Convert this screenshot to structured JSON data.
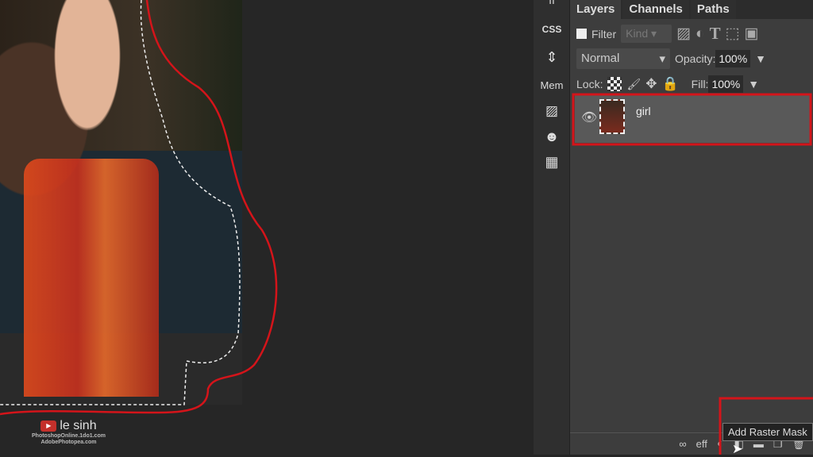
{
  "canvas": {
    "watermark": {
      "brand": "le sinh",
      "line1": "PhotoshopOnline.1do1.com",
      "line2": "AdobePhotopea.com"
    }
  },
  "toolbar": {
    "items": [
      {
        "label": "CSS",
        "icon": "css-icon"
      },
      {
        "label": "",
        "icon": "ruler-icon"
      },
      {
        "label": "Mem",
        "icon": "memory-icon"
      },
      {
        "label": "",
        "icon": "image-icon"
      },
      {
        "label": "",
        "icon": "emoji-icon"
      },
      {
        "label": "",
        "icon": "qr-code-icon"
      }
    ]
  },
  "layers_panel": {
    "tabs": [
      "Layers",
      "Channels",
      "Paths"
    ],
    "filter_label": "Filter",
    "kind_placeholder": "Kind",
    "blend_mode": "Normal",
    "opacity_label": "Opacity:",
    "opacity": "100%",
    "lock_label": "Lock:",
    "fill_label": "Fill:",
    "fill": "100%",
    "layers": [
      {
        "name": "girl",
        "visible": true,
        "selected": true
      }
    ],
    "bottom_icons": [
      "link-icon",
      "eff",
      "adjustment-icon",
      "mask-icon",
      "folder-icon",
      "new-layer-icon",
      "trash-icon"
    ],
    "eff_label": "eff",
    "tooltip": "Add Raster Mask"
  },
  "annotation_color": "#d4141a"
}
